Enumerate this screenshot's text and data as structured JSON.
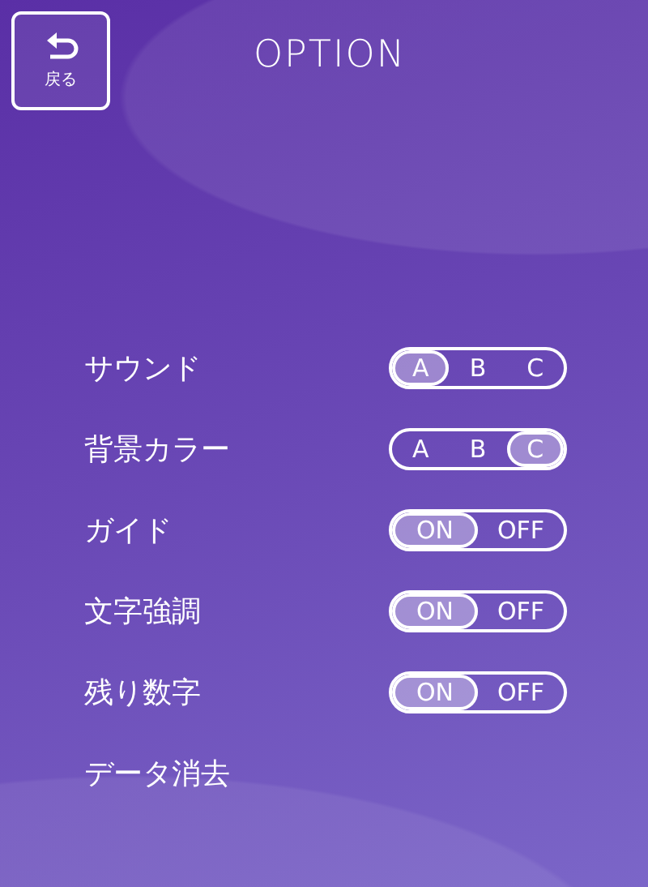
{
  "back_button": {
    "label": "戻る"
  },
  "title": "OPTION",
  "settings": [
    {
      "kind": "choice",
      "label": "サウンド",
      "options": [
        {
          "label": "A",
          "selected": true
        },
        {
          "label": "B",
          "selected": false
        },
        {
          "label": "C",
          "selected": false
        }
      ]
    },
    {
      "kind": "choice",
      "label": "背景カラー",
      "options": [
        {
          "label": "A",
          "selected": false
        },
        {
          "label": "B",
          "selected": false
        },
        {
          "label": "C",
          "selected": true
        }
      ]
    },
    {
      "kind": "choice",
      "label": "ガイド",
      "options": [
        {
          "label": "ON",
          "selected": true
        },
        {
          "label": "OFF",
          "selected": false
        }
      ]
    },
    {
      "kind": "choice",
      "label": "文字強調",
      "options": [
        {
          "label": "ON",
          "selected": true
        },
        {
          "label": "OFF",
          "selected": false
        }
      ]
    },
    {
      "kind": "choice",
      "label": "残り数字",
      "options": [
        {
          "label": "ON",
          "selected": true
        },
        {
          "label": "OFF",
          "selected": false
        }
      ]
    },
    {
      "kind": "action",
      "label": "データ消去"
    }
  ]
}
